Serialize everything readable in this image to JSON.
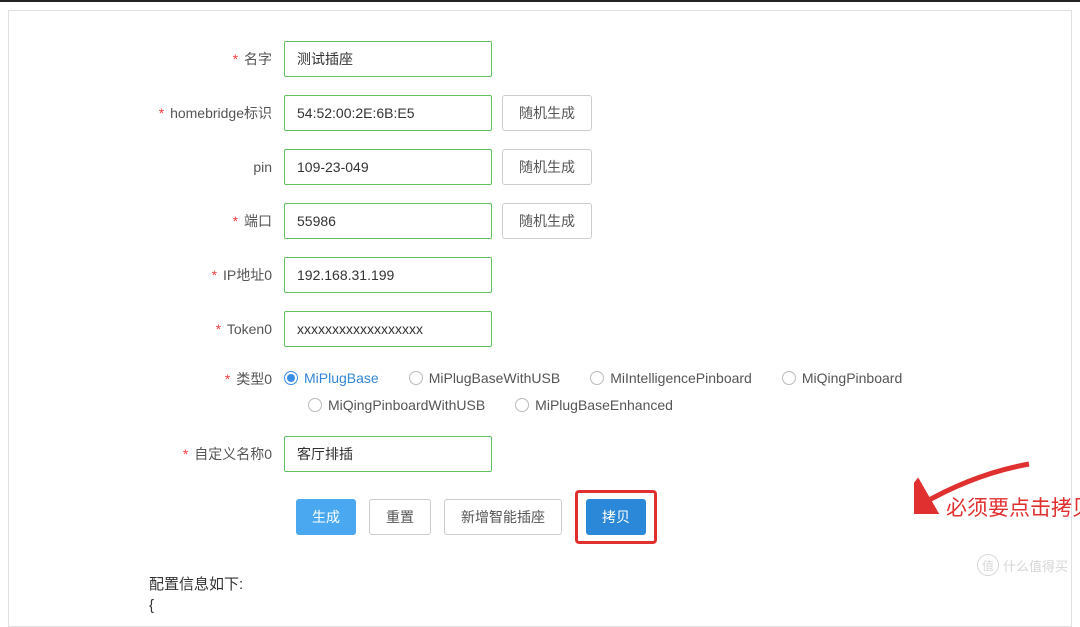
{
  "form": {
    "name": {
      "label": "名字",
      "value": "测试插座"
    },
    "homebridgeId": {
      "label": "homebridge标识",
      "value": "54:52:00:2E:6B:E5",
      "btn": "随机生成"
    },
    "pin": {
      "label": "pin",
      "value": "109-23-049",
      "btn": "随机生成"
    },
    "port": {
      "label": "端口",
      "value": "55986",
      "btn": "随机生成"
    },
    "ip": {
      "label": "IP地址0",
      "value": "192.168.31.199"
    },
    "token": {
      "label": "Token0",
      "value": "xxxxxxxxxxxxxxxxxx"
    },
    "type": {
      "label": "类型0",
      "options": [
        "MiPlugBase",
        "MiPlugBaseWithUSB",
        "MiIntelligencePinboard",
        "MiQingPinboard",
        "MiQingPinboardWithUSB",
        "MiPlugBaseEnhanced"
      ],
      "selected": 0
    },
    "customName": {
      "label": "自定义名称0",
      "value": "客厅排插"
    }
  },
  "actions": {
    "generate": "生成",
    "reset": "重置",
    "addPlug": "新增智能插座",
    "copy": "拷贝"
  },
  "annotation": "必须要点击拷贝复制配置文件",
  "configInfo": {
    "label": "配置信息如下:",
    "brace": "{"
  },
  "watermark": {
    "icon": "值",
    "text": "什么值得买"
  }
}
